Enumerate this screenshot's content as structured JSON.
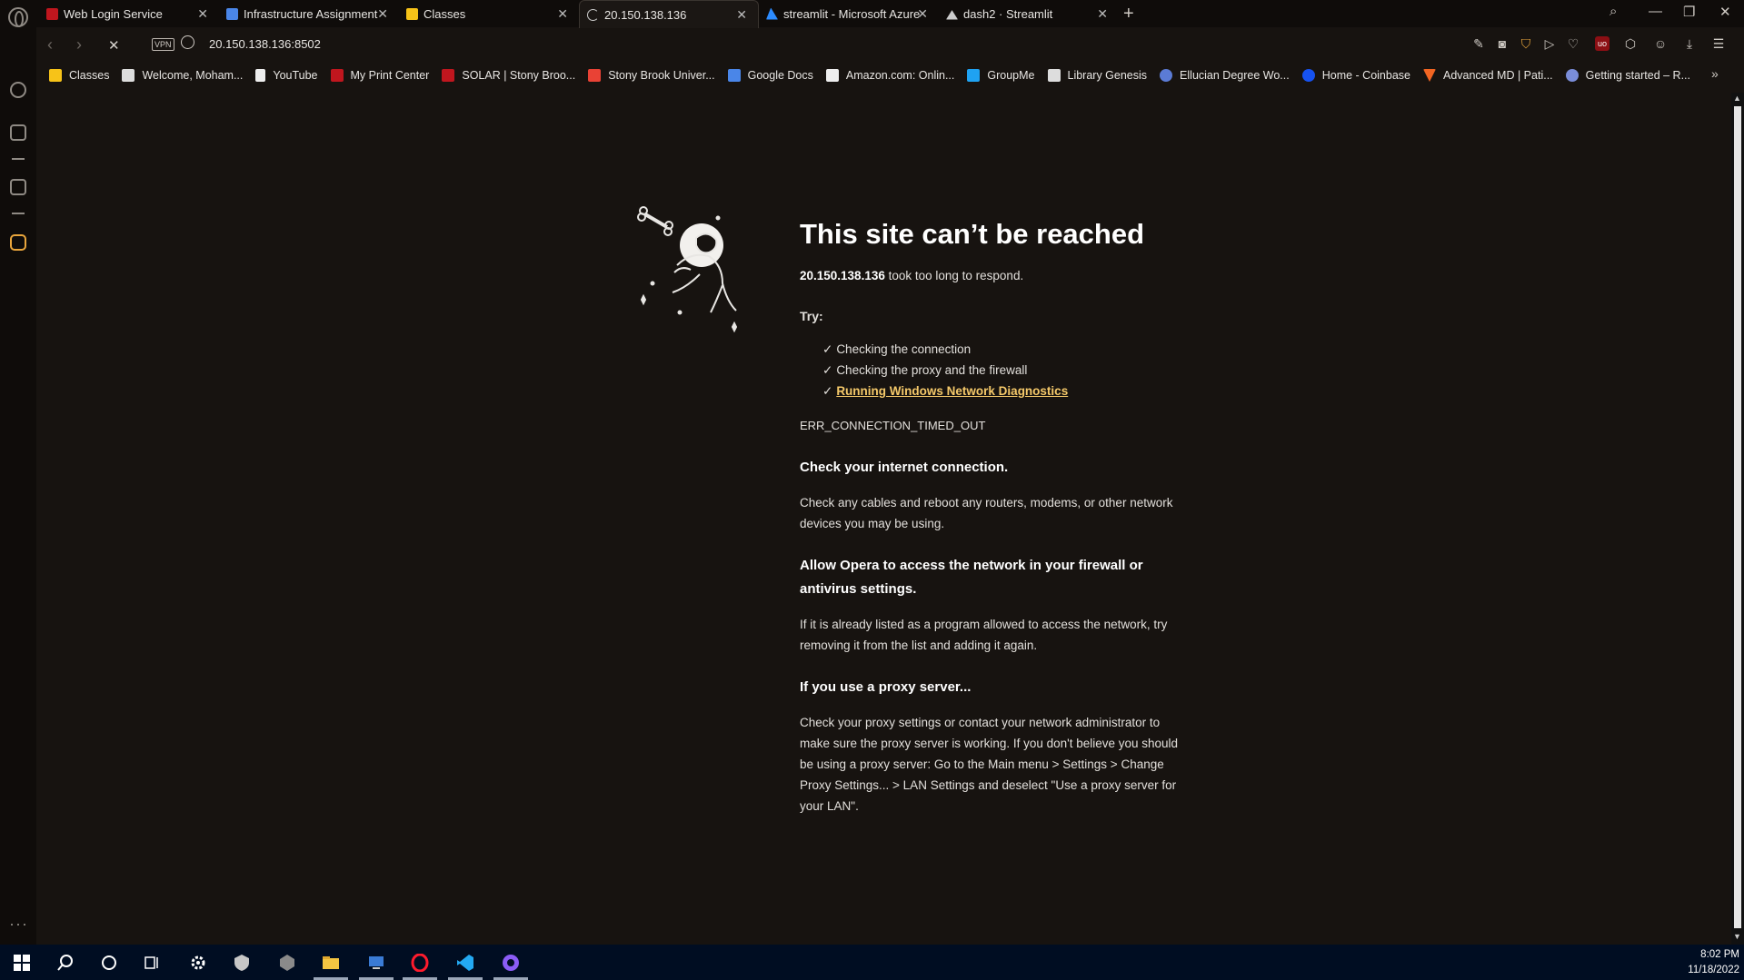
{
  "browser": {
    "tabs": [
      {
        "title": "Web Login Service",
        "favicon": "shield-icon",
        "color": "#c0161e"
      },
      {
        "title": "Infrastructure Assignment",
        "favicon": "docs-icon",
        "color": "#4a86e8"
      },
      {
        "title": "Classes",
        "favicon": "classroom-icon",
        "color": "#f7c318"
      },
      {
        "title": "20.150.138.136",
        "favicon": "loading-spinner-icon",
        "color": "#cccccc",
        "active": true
      },
      {
        "title": "streamlit - Microsoft Azure",
        "favicon": "azure-icon",
        "color": "#2d8cff"
      },
      {
        "title": "dash2 · Streamlit",
        "favicon": "streamlit-icon",
        "color": "#cccccc"
      }
    ],
    "new_tab_label": "+",
    "url": "20.150.138.136:8502",
    "vpn_label": "VPN",
    "bookmarks": [
      {
        "label": "Classes",
        "icon": "classroom-icon",
        "color": "#f7c318"
      },
      {
        "label": "Welcome, Moham...",
        "icon": "blackboard-icon",
        "color": "#dddddd"
      },
      {
        "label": "YouTube",
        "icon": "file-icon",
        "color": "#eeeeee"
      },
      {
        "label": "My Print Center",
        "icon": "shield-icon",
        "color": "#c0161e"
      },
      {
        "label": "SOLAR | Stony Broo...",
        "icon": "shield-icon",
        "color": "#c0161e"
      },
      {
        "label": "Stony Brook Univer...",
        "icon": "gmail-icon",
        "color": "#e94235"
      },
      {
        "label": "Google Docs",
        "icon": "docs-icon",
        "color": "#4a86e8"
      },
      {
        "label": "Amazon.com: Onlin...",
        "icon": "amazon-icon",
        "color": "#eeeeee"
      },
      {
        "label": "GroupMe",
        "icon": "groupme-icon",
        "color": "#1fa2f2"
      },
      {
        "label": "Library Genesis",
        "icon": "book-icon",
        "color": "#dddddd"
      },
      {
        "label": "Ellucian Degree Wo...",
        "icon": "ellucian-icon",
        "color": "#5b7bd5"
      },
      {
        "label": "Home - Coinbase",
        "icon": "coinbase-icon",
        "color": "#1652f0"
      },
      {
        "label": "Advanced MD | Pati...",
        "icon": "advancedmd-icon",
        "color": "#f26522"
      },
      {
        "label": "Getting started – R...",
        "icon": "gear-icon",
        "color": "#7a8dd9"
      }
    ]
  },
  "error_page": {
    "title": "This site can’t be reached",
    "host": "20.150.138.136",
    "host_suffix": " took too long to respond.",
    "try_label": "Try:",
    "suggestions": [
      "Checking the connection",
      "Checking the proxy and the firewall"
    ],
    "diagnostics_link": "Running Windows Network Diagnostics",
    "error_code": "ERR_CONNECTION_TIMED_OUT",
    "sections": [
      {
        "heading": "Check your internet connection.",
        "body": "Check any cables and reboot any routers, modems, or other network devices you may be using."
      },
      {
        "heading": "Allow Opera to access the network in your firewall or antivirus settings.",
        "body": "If it is already listed as a program allowed to access the network, try removing it from the list and adding it again."
      },
      {
        "heading": "If you use a proxy server...",
        "body": "Check your proxy settings or contact your network administrator to make sure the proxy server is working. If you don't believe you should be using a proxy server: Go to the Main menu > Settings > Change Proxy Settings... > LAN Settings and deselect \"Use a proxy server for your LAN\"."
      }
    ]
  },
  "taskbar": {
    "time": "8:02 PM",
    "date": "11/18/2022"
  },
  "colors": {
    "page_bg": "#171310",
    "link": "#f5c96a",
    "taskbar": "#000d22"
  }
}
